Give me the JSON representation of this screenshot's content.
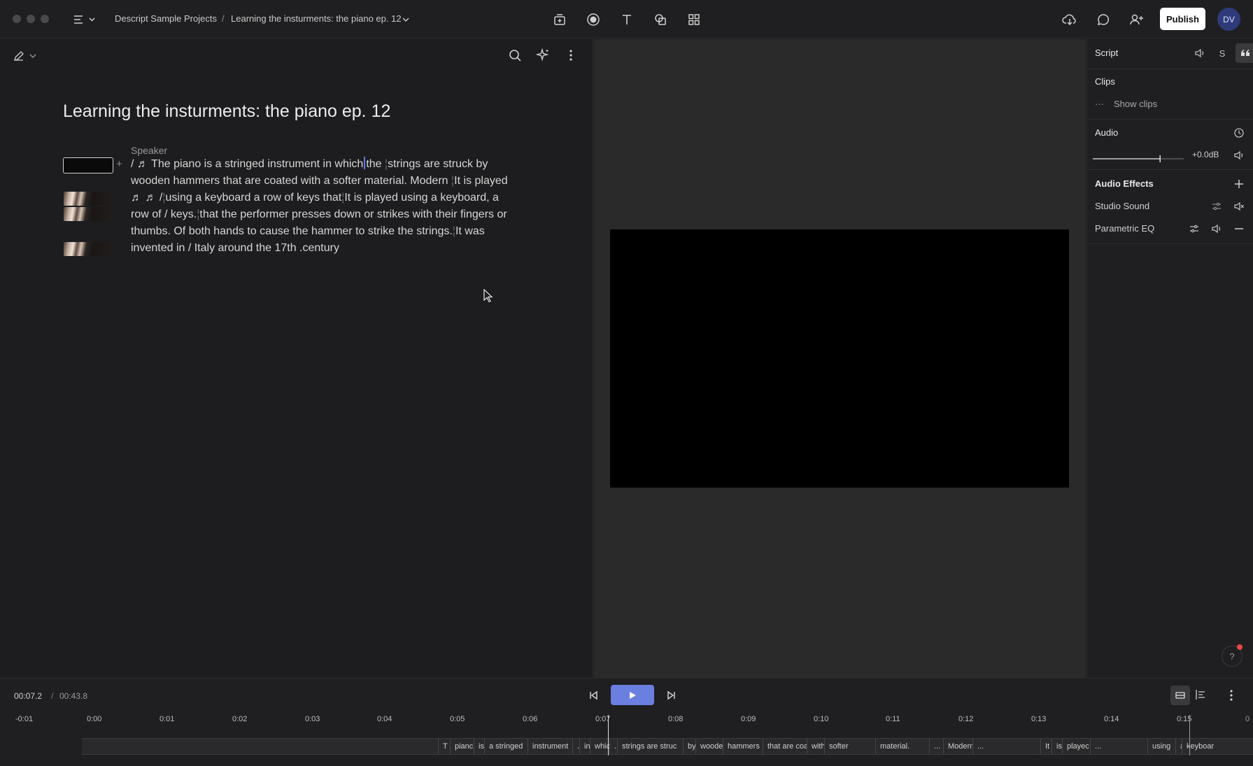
{
  "titlebar": {
    "breadcrumb_project": "Descript Sample Projects",
    "breadcrumb_sep": "/",
    "breadcrumb_file": "Learning the insturments: the piano ep. 12",
    "publish_label": "Publish",
    "avatar_initials": "DV"
  },
  "editor": {
    "doc_title": "Learning the insturments: the piano ep. 12",
    "speaker_label": "Speaker",
    "line1_pre": "/ ♬ The piano is a stringed instrument in which",
    "line1_post": "the ",
    "line1_b": "strings are struck by",
    "line2": "wooden hammers that are coated with a softer material. Modern ",
    "line2_b": "It is played",
    "line3_a": " ♬ ♬ /",
    "line3_b": "using a keyboard a row of keys that",
    "line3_c": "It is played using a keyboard, a",
    "line4_a": "row of / keys.",
    "line4_b": "that the performer presses down or strikes with their fingers or",
    "line5_a": "thumbs. Of both hands to cause the hammer to strike the strings.",
    "line5_b": "It was",
    "line6": "invented in / Italy around the 17th .century"
  },
  "right_panel": {
    "script_label": "Script",
    "script_s": "S",
    "clips_label": "Clips",
    "show_clips": "Show clips",
    "more_glyph": "···",
    "audio_label": "Audio",
    "gain_value": "+0.0dB",
    "gain_level": 0.74,
    "audio_effects_label": "Audio Effects",
    "effects": [
      "Studio Sound",
      "Parametric EQ"
    ],
    "help_glyph": "?"
  },
  "transport": {
    "current_time": "00:07.2",
    "sep": "/",
    "total_time": "00:43.8"
  },
  "timeline": {
    "ticks": [
      "-0:01",
      "0:00",
      "0:01",
      "0:02",
      "0:03",
      "0:04",
      "0:05",
      "0:06",
      "0:07",
      "0:08",
      "0:09",
      "0:10",
      "0:11",
      "0:12",
      "0:13",
      "0:14",
      "0:15"
    ],
    "end_tick": "0",
    "words": [
      "T",
      "pianc",
      "is",
      "a stringed",
      "instrument",
      ".",
      "in",
      "whic",
      "..",
      "strings are struc",
      "by",
      "woode",
      "hammers",
      "that are coat",
      "with",
      "softer",
      "material.",
      "...",
      "Modern",
      "...",
      "It",
      "is",
      "playec",
      "...",
      "using",
      "a",
      "keyboar"
    ]
  },
  "colors": {
    "accent": "#6b7fe0",
    "caret": "#5a7cff",
    "background": "#1d1d1f",
    "notification": "#e54848"
  }
}
